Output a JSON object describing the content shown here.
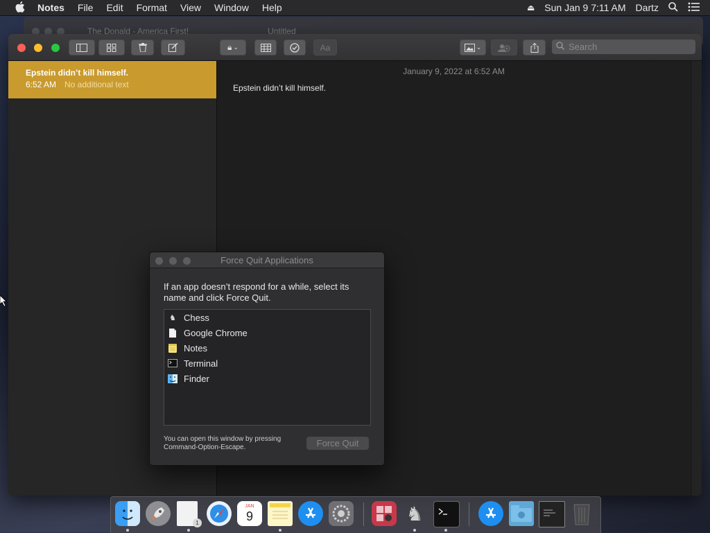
{
  "menubar": {
    "apple": "",
    "app": "Notes",
    "items": [
      "File",
      "Edit",
      "Format",
      "View",
      "Window",
      "Help"
    ],
    "clock": "Sun Jan 9  7:11 AM",
    "user": "Dartz"
  },
  "background_window": {
    "tab1": "The Donald - America First!",
    "tab2": "Untitled"
  },
  "notes": {
    "search_placeholder": "Search",
    "format_button": "Aa",
    "selected_note": {
      "title": "Epstein didn’t kill himself.",
      "time": "6:52 AM",
      "preview": "No additional text"
    },
    "editor": {
      "date": "January 9, 2022 at 6:52 AM",
      "body": "Epstein didn’t kill himself."
    }
  },
  "force_quit": {
    "title": "Force Quit Applications",
    "message": "If an app doesn’t respond for a while, select its name and click Force Quit.",
    "apps": [
      {
        "name": "Chess",
        "icon": "chess-icon"
      },
      {
        "name": "Google Chrome",
        "icon": "document-icon"
      },
      {
        "name": "Notes",
        "icon": "notes-icon"
      },
      {
        "name": "Terminal",
        "icon": "terminal-icon"
      },
      {
        "name": "Finder",
        "icon": "finder-icon"
      }
    ],
    "hint": "You can open this window by pressing Command-Option-Escape.",
    "button": "Force Quit"
  },
  "dock": {
    "calendar_month": "JAN",
    "calendar_day": "9",
    "badge": "1"
  },
  "colors": {
    "selected_note": "#c99a2e",
    "close": "#fe5f57",
    "minimize": "#febc2e",
    "zoom": "#28c840"
  }
}
